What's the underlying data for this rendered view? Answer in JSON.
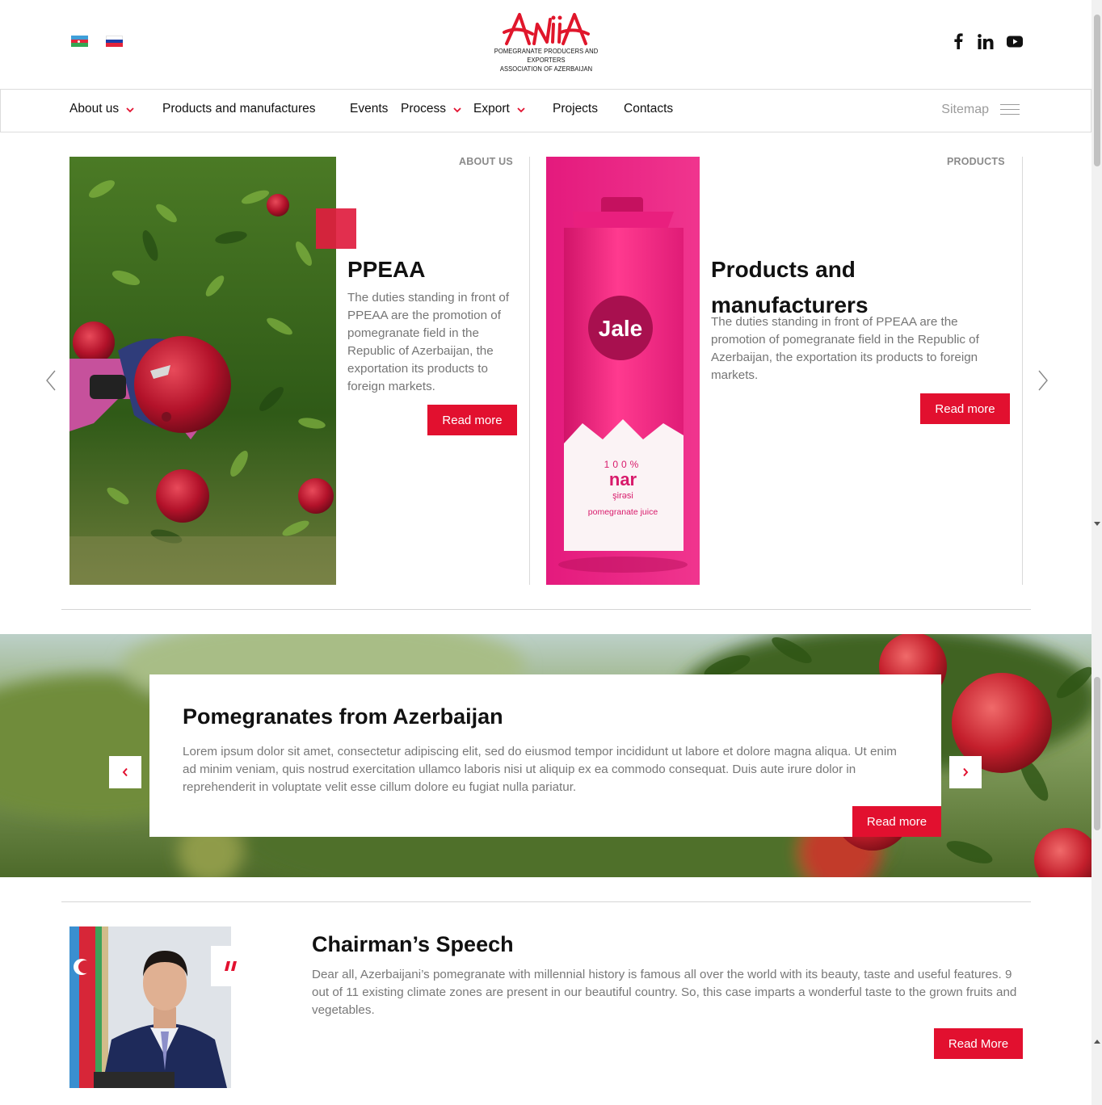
{
  "header": {
    "languages": [
      "Azerbaijani",
      "Russian"
    ],
    "logo": {
      "mark": "ANiiA",
      "line1": "Pomegranate Producers and Exporters",
      "line2": "Association of Azerbaijan"
    },
    "social": [
      "facebook-icon",
      "linkedin-icon",
      "youtube-icon"
    ]
  },
  "nav": {
    "items": [
      {
        "label": "About us",
        "dropdown": true
      },
      {
        "label": "Products and manufactures",
        "dropdown": false
      },
      {
        "label": "Events",
        "dropdown": false
      },
      {
        "label": "Process",
        "dropdown": true
      },
      {
        "label": "Export",
        "dropdown": true
      },
      {
        "label": "Projects",
        "dropdown": false
      },
      {
        "label": "Contacts",
        "dropdown": false
      }
    ],
    "sitemap_label": "Sitemap"
  },
  "cards": [
    {
      "category": "ABOUT US",
      "title": "PPEAA",
      "text": "The duties standing in front of PPEAA are the promotion of pomegranate field in the Republic of Azerbaijan, the exportation its products to foreign markets.",
      "button": "Read more"
    },
    {
      "category": "PRODUCTS",
      "title": "Products and manufacturers",
      "text": "The duties standing in front of PPEAA are the promotion of pomegranate field in the Republic of Azerbaijan, the exportation its products to foreign markets.",
      "button": "Read more",
      "product": {
        "brand": "Jale",
        "line1": "100%",
        "line2": "nar",
        "line3": "şirəsi",
        "line4": "pomegranate juice"
      }
    }
  ],
  "banner": {
    "title": "Pomegranates from Azerbaijan",
    "text": "Lorem ipsum dolor sit amet, consectetur adipiscing elit, sed do eiusmod tempor incididunt ut labore et dolore magna aliqua. Ut enim ad minim veniam, quis nostrud exercitation ullamco laboris nisi ut aliquip ex ea commodo consequat. Duis aute irure dolor in reprehenderit in voluptate velit esse cillum dolore eu fugiat nulla pariatur.",
    "button": "Read more"
  },
  "chairman": {
    "title": "Chairman’s Speech",
    "text": "Dear all, Azerbaijani’s pomegranate with millennial history is famous all over the world with its beauty, taste and useful features. 9 out of 11 existing climate zones are present in our beautiful country. So, this case imparts a wonderful taste to the grown fruits and vegetables.",
    "button": "Read More",
    "quote_mark": "\""
  },
  "colors": {
    "accent": "#e2102f",
    "text_muted": "#787878",
    "logo_red": "#e0162b"
  }
}
